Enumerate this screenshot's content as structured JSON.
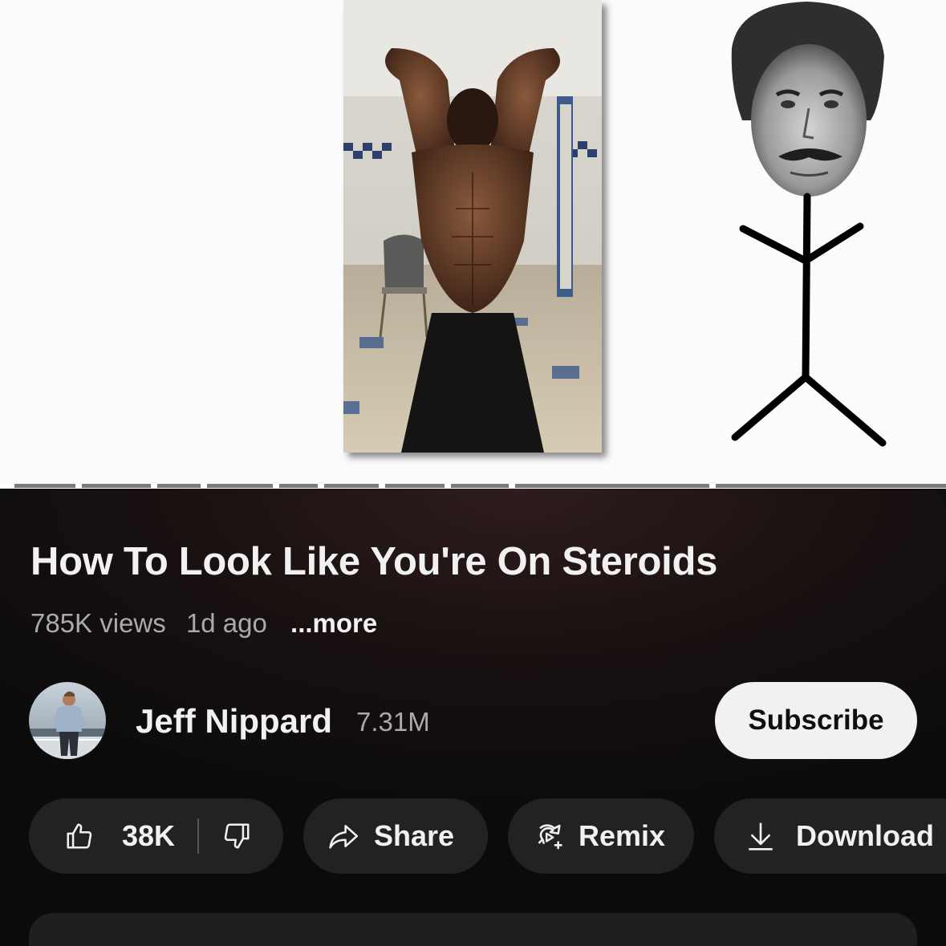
{
  "video": {
    "description_left": "shirtless-bodybuilder-photo",
    "description_right": "stick-figure-with-photo-head"
  },
  "title": "How To Look Like You're On Steroids",
  "meta": {
    "views": "785K views",
    "age": "1d ago",
    "more": "...more"
  },
  "channel": {
    "name": "Jeff Nippard",
    "subscribers": "7.31M",
    "subscribe_label": "Subscribe"
  },
  "actions": {
    "likes": "38K",
    "share": "Share",
    "remix": "Remix",
    "download": "Download"
  },
  "colors": {
    "background": "#0f0f0f",
    "pill": "#222222",
    "text_primary": "#f1f1f1",
    "text_secondary": "#aaaaaa",
    "subscribe_bg": "#f1f1f1"
  }
}
